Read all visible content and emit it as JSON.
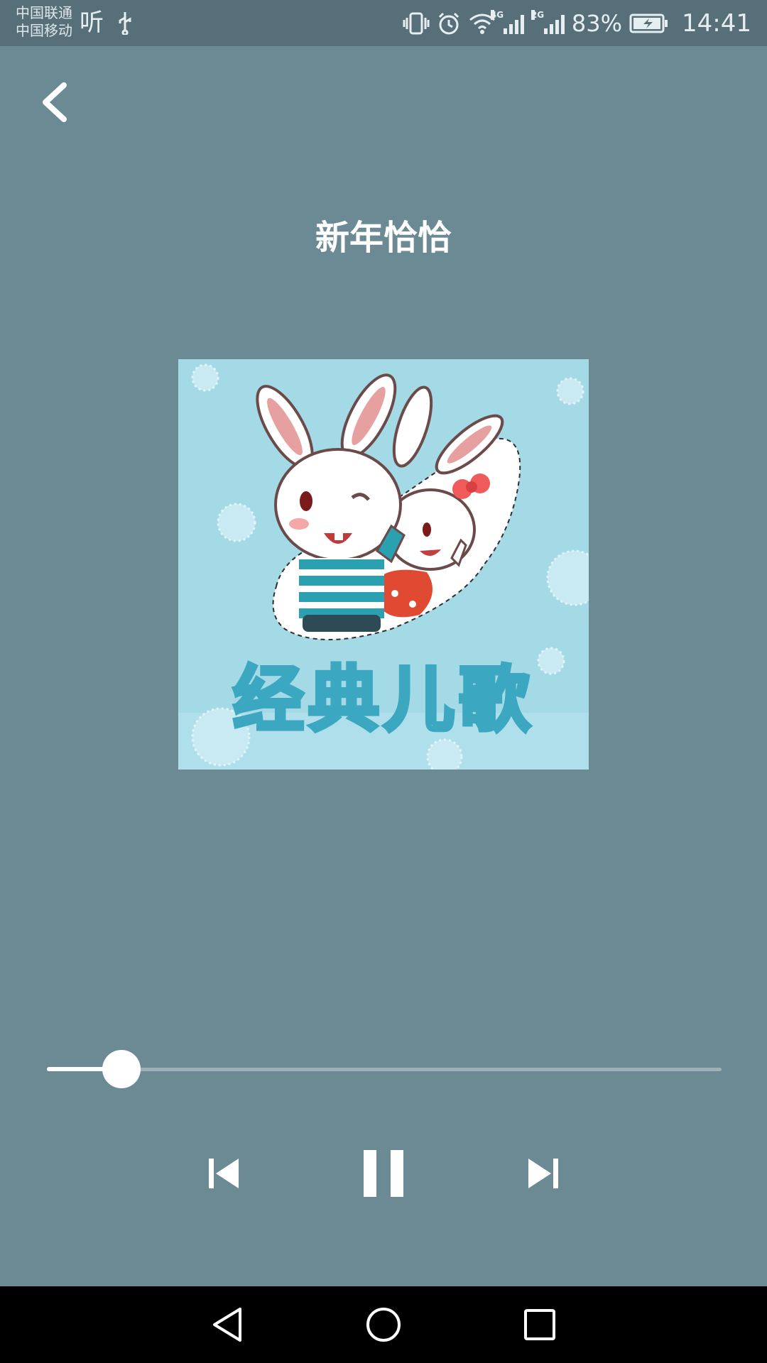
{
  "status_bar": {
    "carrier1": "中国联通",
    "carrier2": "中国移动",
    "ting": "听",
    "net1": "4G",
    "net2": "2G",
    "battery_percent": "83%",
    "time": "14:41"
  },
  "player": {
    "title": "新年恰恰",
    "album_text": "经典儿歌",
    "progress_fraction": 0.11
  },
  "colors": {
    "background": "#6b8a94",
    "status_bar": "#566f78",
    "album_bg": "#a4d9e6",
    "accent": "#ffffff"
  },
  "icons": {
    "back": "chevron-left-icon",
    "prev": "skip-previous-icon",
    "pause": "pause-icon",
    "next": "skip-next-icon",
    "nav_back": "triangle-back-icon",
    "nav_home": "circle-home-icon",
    "nav_recent": "square-recent-icon"
  }
}
